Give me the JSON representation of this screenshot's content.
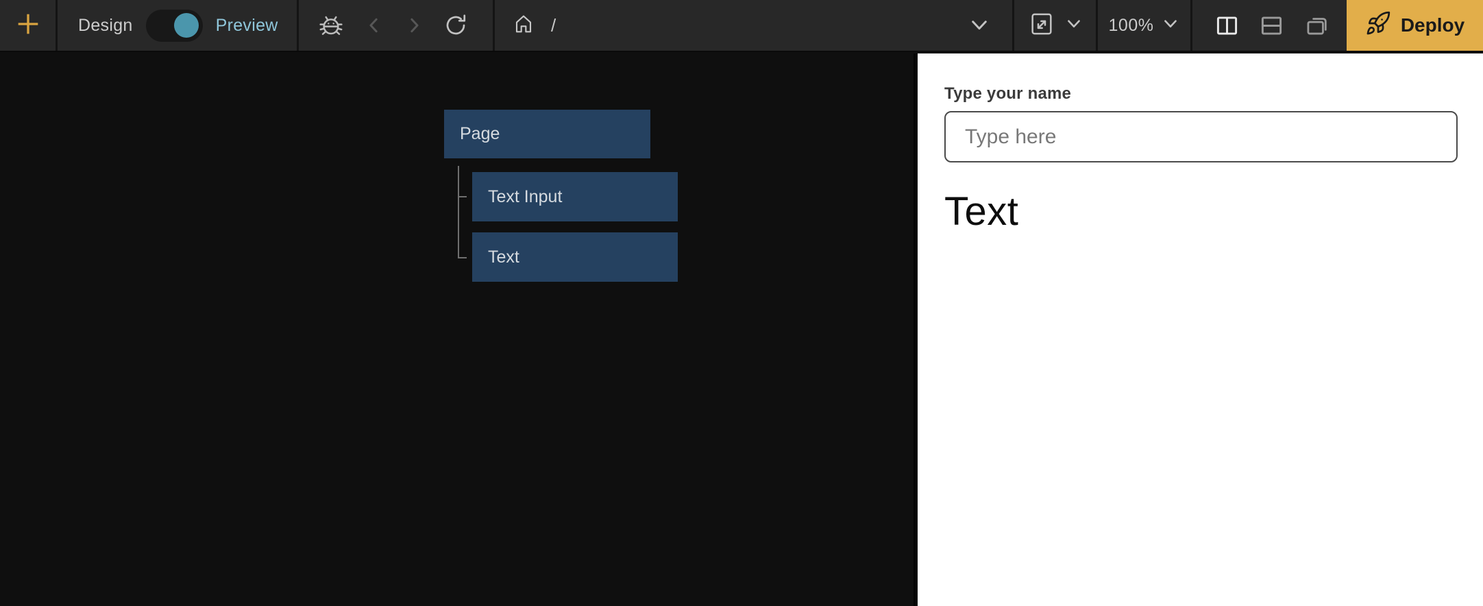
{
  "toolbar": {
    "design_label": "Design",
    "preview_label": "Preview",
    "toggle_state": "preview",
    "path": "/",
    "zoom_level": "100%",
    "deploy_label": "Deploy",
    "icons": [
      "plus-icon",
      "bug-icon",
      "chevron-left-icon",
      "chevron-right-icon",
      "refresh-icon",
      "home-icon",
      "chevron-down-icon",
      "screen-size-icon",
      "split-vertical-icon",
      "split-horizontal-icon",
      "floating-window-icon",
      "rocket-icon"
    ]
  },
  "tree": {
    "root": {
      "label": "Page"
    },
    "children": [
      {
        "label": "Text Input"
      },
      {
        "label": "Text"
      }
    ]
  },
  "preview": {
    "name_label": "Type your name",
    "input_placeholder": "Type here",
    "text_value": "Text"
  },
  "colors": {
    "toolbar_bg": "#282828",
    "canvas_bg": "#0f0f0f",
    "accent_teal": "#4b96ac",
    "preview_label_teal": "#8fc6da",
    "amber_plus": "#d9a440",
    "deploy_yellow": "#e2ae4a",
    "tree_node_blue": "#254160",
    "tree_node_text": "#d6dbe0",
    "panel_bg": "#ffffff",
    "input_border": "#4a4a4a",
    "placeholder_gray": "#787878"
  }
}
